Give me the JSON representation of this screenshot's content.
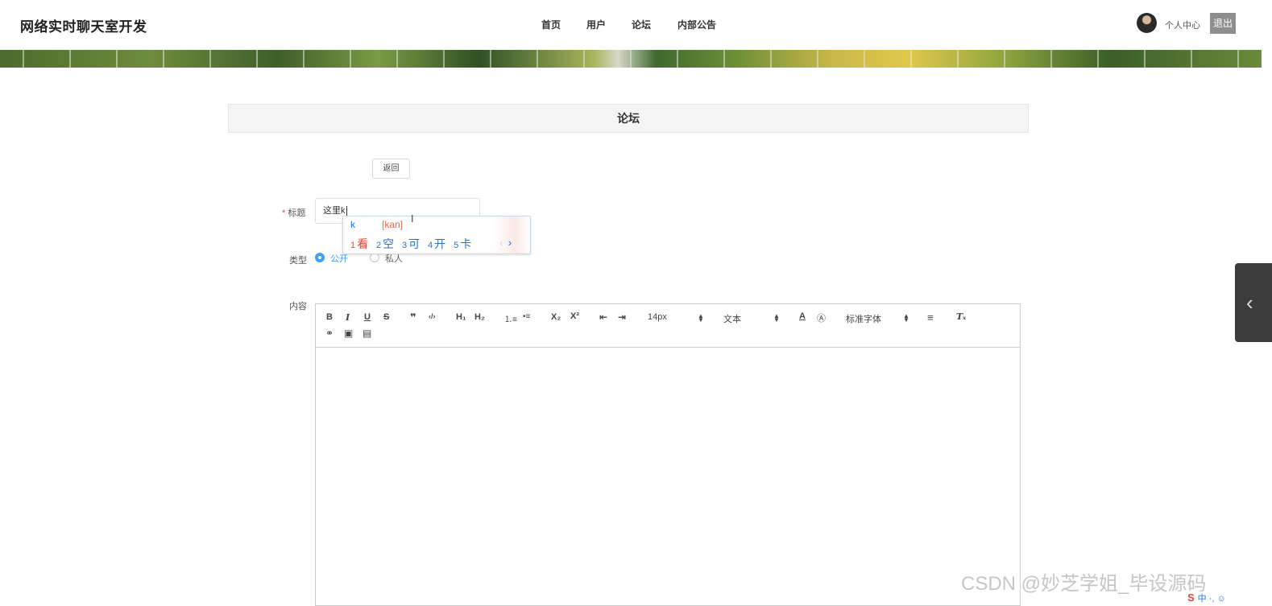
{
  "header": {
    "brand": "网络实时聊天室开发",
    "nav": [
      "首页",
      "用户",
      "论坛",
      "内部公告"
    ],
    "user_center": "个人中心",
    "logout": "退出"
  },
  "panel": {
    "title": "论坛",
    "back_label": "返回"
  },
  "form": {
    "title_label": "标题",
    "required_mark": "*",
    "title_value": "这里k",
    "type_label": "类型",
    "type_options": [
      {
        "label": "公开",
        "selected": true
      },
      {
        "label": "私人",
        "selected": false
      }
    ],
    "content_label": "内容"
  },
  "ime": {
    "typed": "k",
    "pinyin": "[kan]",
    "candidates": [
      {
        "num": "1",
        "text": "看"
      },
      {
        "num": "2",
        "text": "空"
      },
      {
        "num": "3",
        "text": "可"
      },
      {
        "num": "4",
        "text": "开"
      },
      {
        "num": "5",
        "text": "卡"
      }
    ],
    "prev": "‹",
    "next": "›"
  },
  "editor": {
    "toolbar": {
      "bold": "B",
      "italic": "I",
      "underline": "U",
      "strike": "S",
      "quote": "❞",
      "code": "‹/›",
      "h1": "H₁",
      "h2": "H₂",
      "ordered_list": "⒈≡",
      "bullet_list": "•≡",
      "subscript": "X₂",
      "superscript": "X²",
      "outdent": "⇤",
      "indent": "⇥",
      "size": "14px",
      "header": "文本",
      "font_color": "A",
      "background": "Ⓐ",
      "font": "标准字体",
      "align": "≡",
      "clean": "Tₓ",
      "link": "⚭",
      "image": "▣",
      "video": "▤"
    },
    "content": ""
  },
  "side_tab_icon": "‹",
  "watermark": "CSDN @妙芝学姐_毕设源码",
  "ime_status": {
    "logo": "S",
    "mode": "中 ·, ☺"
  },
  "colors": {
    "accent": "#409eff",
    "required": "#e84a4a",
    "ime_blue": "#2b6ed9",
    "ime_red": "#e0483a"
  }
}
